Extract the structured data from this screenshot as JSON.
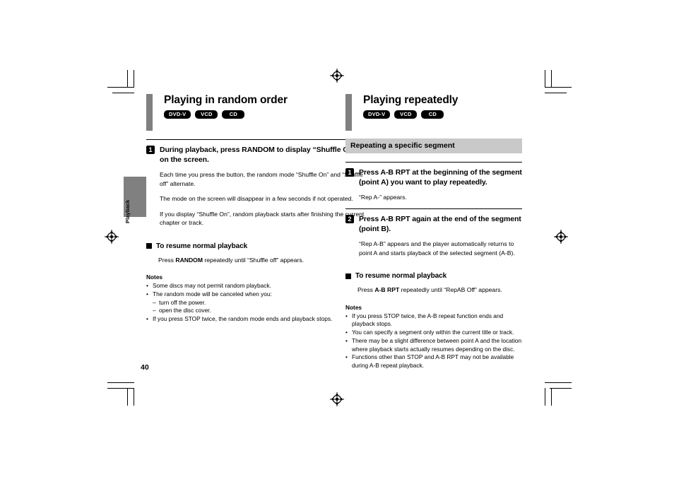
{
  "page": {
    "number": "40",
    "side_tab_label": "Playback"
  },
  "left_column": {
    "title": "Playing in random order",
    "badges": [
      "DVD-V",
      "VCD",
      "CD"
    ],
    "steps": [
      {
        "number": "1",
        "title": "During playback, press RANDOM to display “Shuffle On” on the screen.",
        "paragraphs": [
          "Each time you press the button, the random mode “Shuffle On” and “Shuffle off” alternate.",
          "The mode on the screen will disappear in a few seconds if not operated.",
          "If you display “Shuffle On”, random playback starts after finishing the current chapter or track."
        ]
      }
    ],
    "subsection": {
      "heading": "To resume normal playback",
      "body_prefix": "Press ",
      "body_bold": "RANDOM",
      "body_suffix": " repeatedly until “Shuffle off” appears."
    },
    "notes": {
      "title": "Notes",
      "items": [
        {
          "text": "Some discs may not permit random playback.",
          "subitems": []
        },
        {
          "text": "The random mode will be canceled when you:",
          "subitems": [
            "turn off the power.",
            "open the disc cover."
          ]
        },
        {
          "text": "If you press STOP twice, the random mode ends and playback stops.",
          "subitems": []
        }
      ]
    }
  },
  "right_column": {
    "title": "Playing repeatedly",
    "badges": [
      "DVD-V",
      "VCD",
      "CD"
    ],
    "section_bar": "Repeating a specific segment",
    "steps": [
      {
        "number": "1",
        "title": "Press A-B RPT at the beginning of the segment (point A) you want to play repeatedly.",
        "paragraphs": [
          "“Rep A-” appears."
        ]
      },
      {
        "number": "2",
        "title": "Press A-B RPT again at the end of the segment (point B).",
        "paragraphs": [
          "“Rep A-B” appears and the player automatically returns to point A and starts playback of the selected segment (A-B)."
        ]
      }
    ],
    "subsection": {
      "heading": "To resume normal playback",
      "body_prefix": "Press ",
      "body_bold": "A-B RPT",
      "body_suffix": " repeatedly until “RepAB Off” appears."
    },
    "notes": {
      "title": "Notes",
      "items": [
        {
          "text": "If you press STOP twice, the A-B repeat function ends and playback stops.",
          "subitems": []
        },
        {
          "text": "You can specify a segment only within the current title or track.",
          "subitems": []
        },
        {
          "text": "There may be a slight difference between point A and the location where playback starts actually resumes depending on the disc.",
          "subitems": []
        },
        {
          "text": "Functions other than STOP and A-B RPT may not be available during A-B repeat playback.",
          "subitems": []
        }
      ]
    }
  },
  "colors": {
    "accent_gray": "#808080",
    "section_bar_gray": "#c9c9c9",
    "badge_black": "#000000"
  }
}
